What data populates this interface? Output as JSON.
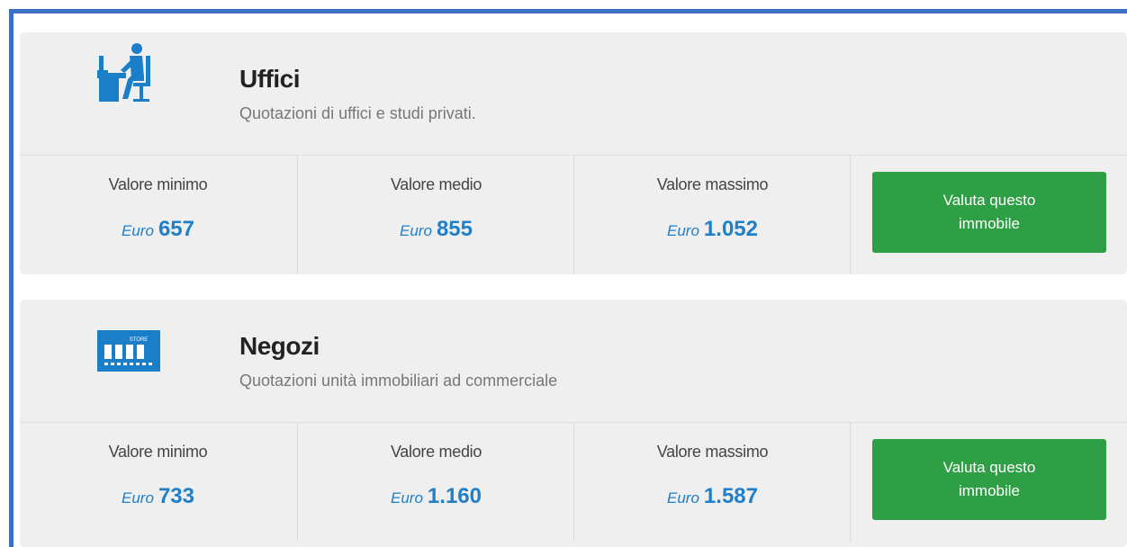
{
  "colors": {
    "frame": "#3a6fc1",
    "accent_blue": "#1f7fc8",
    "button_green": "#2e9f44",
    "card_bg": "#efefef"
  },
  "cards": [
    {
      "icon": "office-worker-icon",
      "title": "Uffici",
      "subtitle": "Quotazioni di uffici e studi privati.",
      "min_label": "Valore minimo",
      "min_currency": "Euro",
      "min_value": "657",
      "avg_label": "Valore medio",
      "avg_currency": "Euro",
      "avg_value": "855",
      "max_label": "Valore massimo",
      "max_currency": "Euro",
      "max_value": "1.052",
      "button_label": "Valuta questo immobile"
    },
    {
      "icon": "store-icon",
      "title": "Negozi",
      "subtitle": "Quotazioni unità immobiliari ad commerciale",
      "min_label": "Valore minimo",
      "min_currency": "Euro",
      "min_value": "733",
      "avg_label": "Valore medio",
      "avg_currency": "Euro",
      "avg_value": "1.160",
      "max_label": "Valore massimo",
      "max_currency": "Euro",
      "max_value": "1.587",
      "button_label": "Valuta questo immobile",
      "icon_text": "STORE"
    }
  ]
}
